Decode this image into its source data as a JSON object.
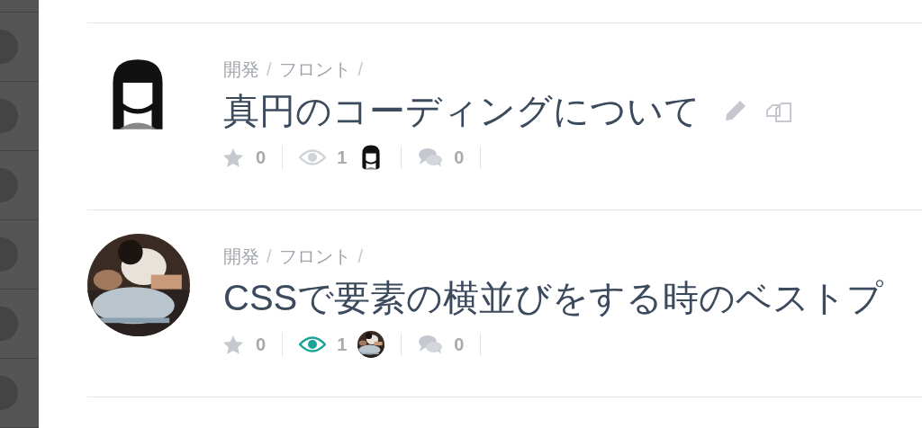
{
  "posts": [
    {
      "avatar": {
        "kind": "illustration"
      },
      "breadcrumb": [
        {
          "kind": "link",
          "text": "開発"
        },
        {
          "kind": "separator",
          "text": "/"
        },
        {
          "kind": "link",
          "text": "フロント"
        },
        {
          "kind": "separator",
          "text": "/"
        }
      ],
      "title": "真円のコーディングについて",
      "actions": true,
      "stars": "0",
      "views": "1",
      "viewed": false,
      "viewer": {
        "kind": "illustration"
      },
      "comments": "0"
    },
    {
      "breadcrumb": [
        {
          "kind": "link",
          "text": "開発"
        },
        {
          "kind": "separator",
          "text": "/"
        },
        {
          "kind": "link",
          "text": "フロント"
        },
        {
          "kind": "separator",
          "text": "/"
        }
      ],
      "title": "CSSで要素の横並びをする時のベストプ",
      "actions": false,
      "stars": "0",
      "views": "1",
      "viewed": true,
      "comments": "0"
    }
  ]
}
